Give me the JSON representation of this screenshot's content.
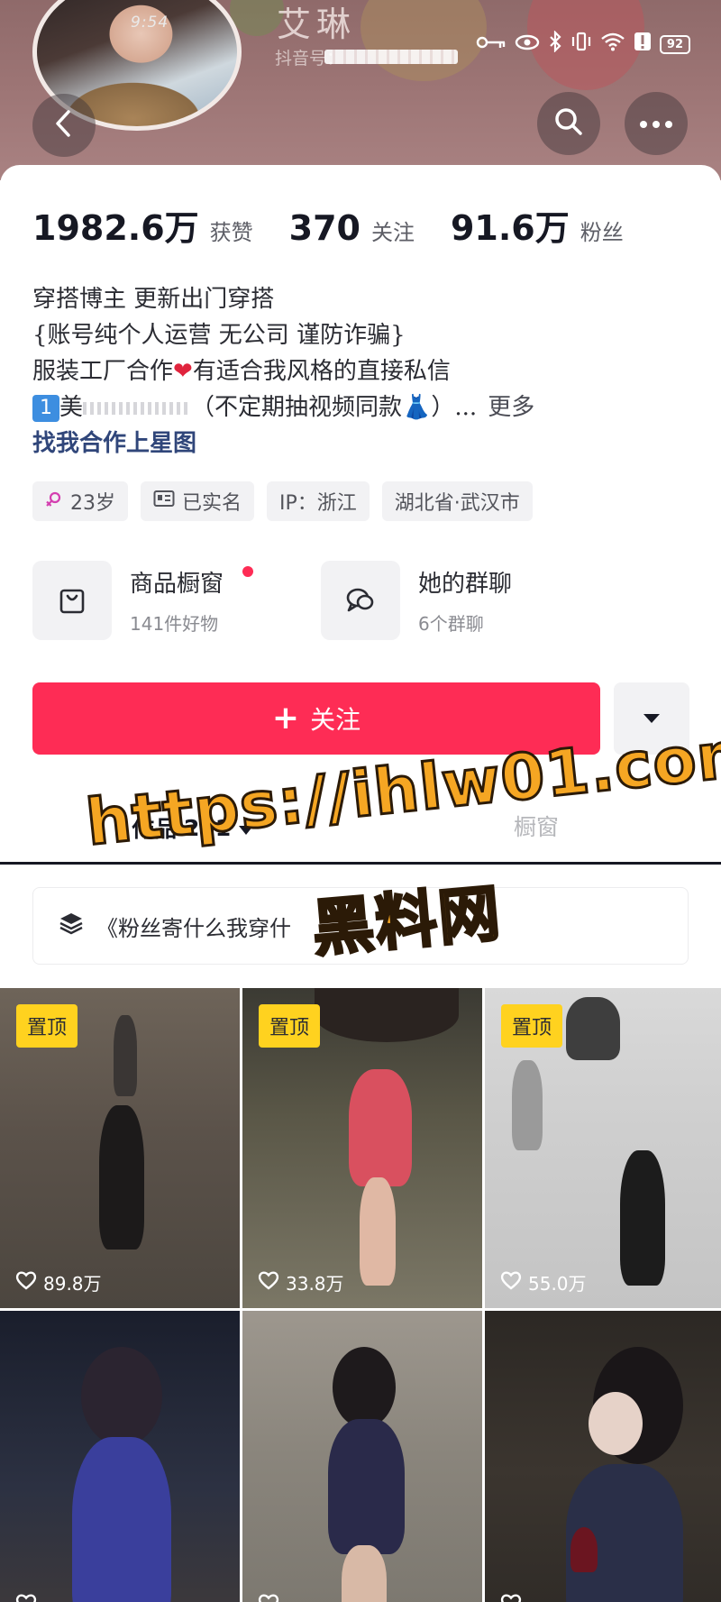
{
  "header": {
    "nickname": "艾琳",
    "douyin_id_label": "抖音号：",
    "avatar_time": "9:54",
    "battery": "92"
  },
  "stats": [
    {
      "value": "1982.6万",
      "label": "获赞"
    },
    {
      "value": "370",
      "label": "关注"
    },
    {
      "value": "91.6万",
      "label": "粉丝"
    }
  ],
  "bio": {
    "line1": "穿搭博主 更新出门穿搭",
    "line2": "{账号纯个人运营 无公司 谨防诈骗}",
    "line3_a": "服装工厂合作",
    "line3_b": "有适合我风格的直接私信",
    "line4_badge": "1",
    "line4_a": "美",
    "line4_b": "（不定期抽视频同款",
    "line4_c": "）...",
    "more": "更多",
    "link": "找我合作上星图"
  },
  "tags": {
    "age": "23岁",
    "verified": "已实名",
    "ip": "IP：浙江",
    "location": "湖北省·武汉市"
  },
  "features": {
    "shop_title": "商品橱窗",
    "shop_sub": "141件好物",
    "group_title": "她的群聊",
    "group_sub": "6个群聊"
  },
  "follow": {
    "plus": "+",
    "label": "关注"
  },
  "tabs": {
    "works_label": "作品",
    "works_count": "221",
    "window_label": "橱窗"
  },
  "collection": {
    "label": "《粉丝寄什么我穿什"
  },
  "watermark": {
    "line1": "https://ihlw01.com",
    "line2": "黑料网"
  },
  "videos": [
    {
      "pinned": "置顶",
      "likes": "89.8万"
    },
    {
      "pinned": "置顶",
      "likes": "33.8万"
    },
    {
      "pinned": "置顶",
      "likes": "55.0万"
    },
    {
      "pinned": "",
      "likes": ""
    },
    {
      "pinned": "",
      "likes": ""
    },
    {
      "pinned": "",
      "likes": ""
    }
  ],
  "colors": {
    "accent": "#fe2c55",
    "pin_badge": "#ffd21f",
    "watermark": "#f5a623"
  }
}
